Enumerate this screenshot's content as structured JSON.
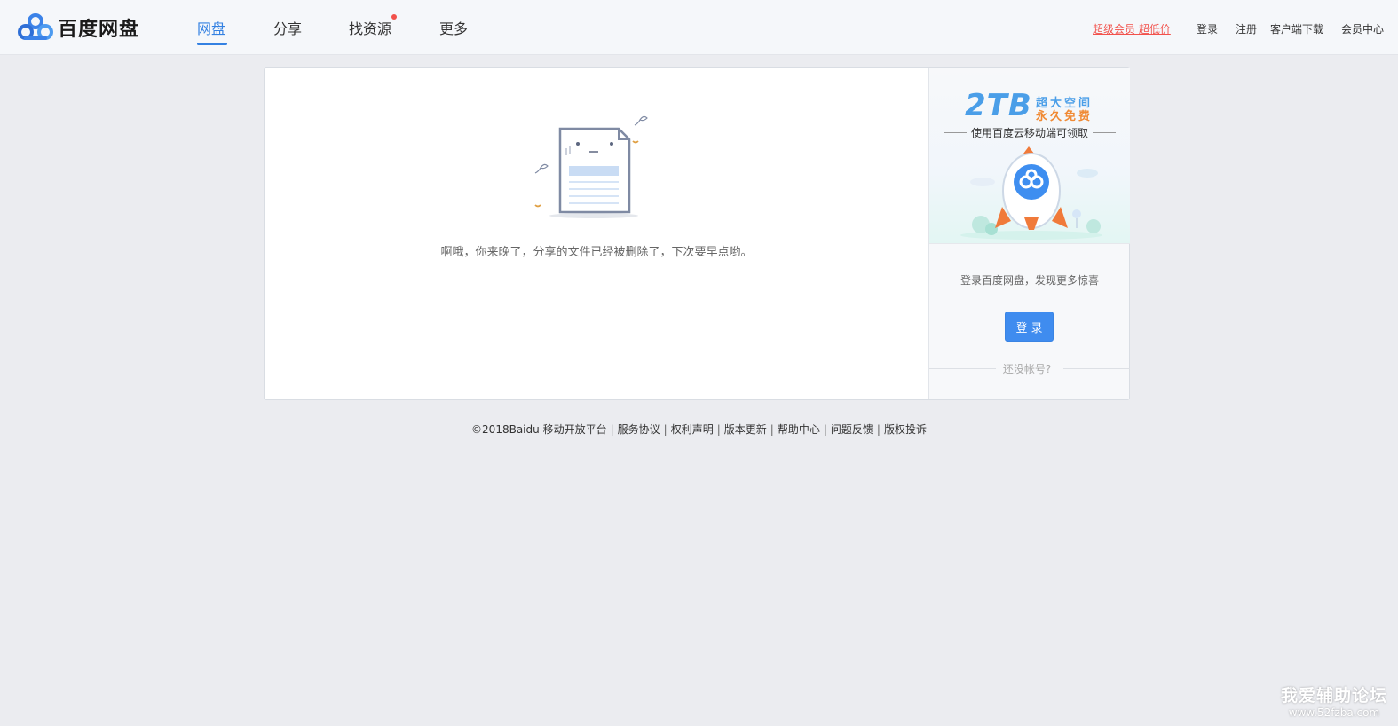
{
  "header": {
    "logo_text": "百度网盘",
    "nav": [
      {
        "label": "网盘"
      },
      {
        "label": "分享"
      },
      {
        "label": "找资源"
      },
      {
        "label": "更多"
      }
    ],
    "promo_link": "超级会员 超低价",
    "login_link": "登录",
    "register_link": "注册",
    "client_download": "客户端下载",
    "member_center": "会员中心"
  },
  "main": {
    "error_message": "啊哦，你来晚了，分享的文件已经被删除了，下次要早点哟。"
  },
  "sidebar": {
    "promo_big": "2TB",
    "promo_line1": "超大空间",
    "promo_line2": "永久免费",
    "promo_mobile": "使用百度云移动端可领取",
    "login_tip": "登录百度网盘，发现更多惊喜",
    "login_button": "登录",
    "no_account": "还没帐号?"
  },
  "footer": {
    "copyright": "©2018Baidu",
    "links": [
      "移动开放平台",
      "服务协议",
      "权利声明",
      "版本更新",
      "帮助中心",
      "问题反馈",
      "版权投诉"
    ]
  },
  "watermark": {
    "line1": "我爱辅助论坛",
    "line2": "www.52fzba.com"
  },
  "colors": {
    "accent": "#3481e2",
    "promo_red": "#f2514b",
    "login_button": "#3f8cef",
    "page_bg": "#ebecf0"
  }
}
